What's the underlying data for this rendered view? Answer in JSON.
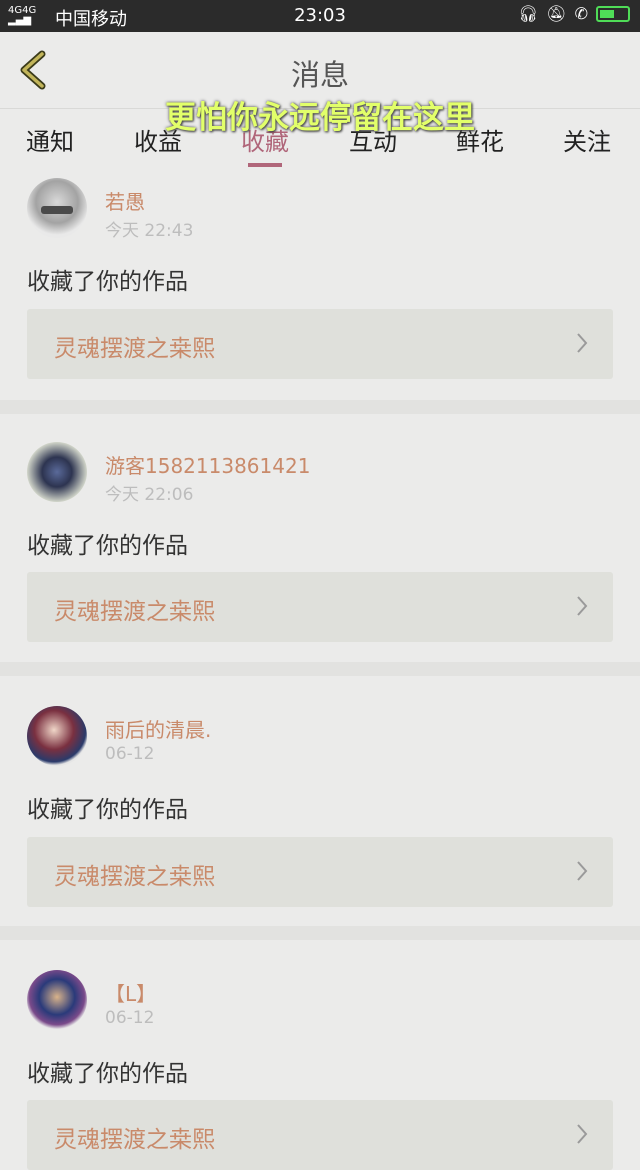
{
  "status_bar": {
    "signal": "4G 4G",
    "carrier": "中国移动",
    "time": "23:03",
    "icons": [
      "headset-icon",
      "bell-mute-icon",
      "hd-call-icon",
      "battery-charging-icon"
    ],
    "battery_level": 0.55
  },
  "header": {
    "title": "消息",
    "overlay_caption": "更怕你永远停留在这里"
  },
  "tabs": [
    {
      "label": "通知"
    },
    {
      "label": "收益"
    },
    {
      "label": "收藏",
      "active": true
    },
    {
      "label": "互动"
    },
    {
      "label": "鲜花"
    },
    {
      "label": "关注"
    }
  ],
  "notifications": [
    {
      "user": "若愚",
      "time": "今天 22:43",
      "action": "收藏了你的作品",
      "work": "灵魂摆渡之桒熙"
    },
    {
      "user": "游客1582113861421",
      "time": "今天 22:06",
      "action": "收藏了你的作品",
      "work": "灵魂摆渡之桒熙"
    },
    {
      "user": "雨后的清晨.",
      "time": "06-12",
      "action": "收藏了你的作品",
      "work": "灵魂摆渡之桒熙"
    },
    {
      "user": "【L】",
      "time": "06-12",
      "action": "收藏了你的作品",
      "work": "灵魂摆渡之桒熙"
    }
  ],
  "colors": {
    "accent": "#b0667a",
    "username": "#c98a6a",
    "background": "#ebebea",
    "caption": "#e2ff6a"
  }
}
